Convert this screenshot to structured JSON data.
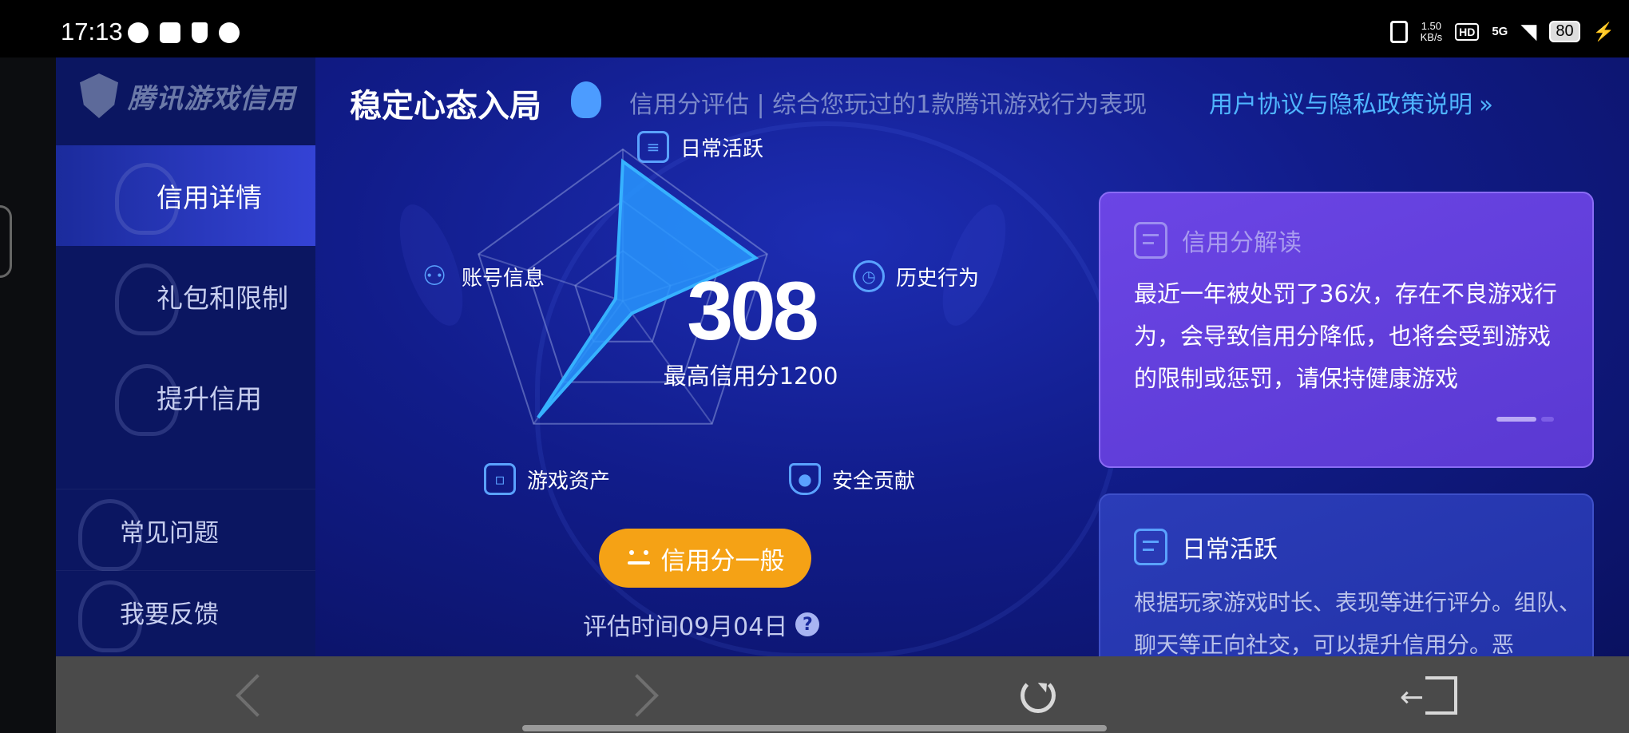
{
  "status_bar": {
    "time": "17:13",
    "net_speed_top": "1.50",
    "net_speed_bottom": "KB/s",
    "hd": "HD",
    "network": "5G",
    "battery": "80"
  },
  "sidebar": {
    "logo_text": "腾讯游戏信用",
    "items": [
      {
        "label": "信用详情",
        "active": true
      },
      {
        "label": "礼包和限制",
        "active": false
      },
      {
        "label": "提升信用",
        "active": false
      }
    ],
    "sub_items": [
      {
        "label": "常见问题"
      },
      {
        "label": "我要反馈"
      }
    ]
  },
  "header": {
    "title": "稳定心态入局",
    "subtitle": "信用分评估 | 综合您玩过的1款腾讯游戏行为表现",
    "link": "用户协议与隐私政策说明"
  },
  "radar": {
    "labels": {
      "daily": "日常活跃",
      "history": "历史行为",
      "security": "安全贡献",
      "assets": "游戏资产",
      "account": "账号信息"
    },
    "values": {
      "daily": 0.92,
      "history": 0.92,
      "security": 0.1,
      "assets": 0.95,
      "account": 0.05
    },
    "score": "308",
    "max_score": "最高信用分1200",
    "level_badge": "信用分一般",
    "eval_time": "评估时间09月04日",
    "help": "?"
  },
  "card_interpret": {
    "title": "信用分解读",
    "body": "最近一年被处罚了36次，存在不良游戏行为，会导致信用分降低，也将会受到游戏的限制或惩罚，请保持健康游戏"
  },
  "card_daily": {
    "title": "日常活跃",
    "body": "根据玩家游戏时长、表现等进行评分。组队、聊天等正向社交，可以提升信用分。恶"
  },
  "colors": {
    "accent_blue": "#4fb4ff",
    "badge_orange": "#f5a215",
    "card_purple": "#6b45e5"
  }
}
